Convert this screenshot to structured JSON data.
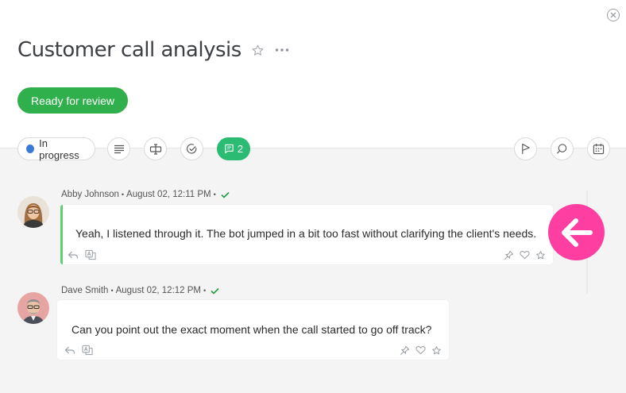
{
  "header": {
    "title": "Customer call analysis",
    "status_button": "Ready for review"
  },
  "toolbar": {
    "state_label": "In progress",
    "comment_count": "2",
    "colors": {
      "state_dot": "#3a7bd5",
      "comments_pill": "#2cbb73",
      "status_button": "#2fb04c"
    },
    "left_icons": [
      "description-icon",
      "custom-fields-icon",
      "checklist-icon",
      "comments-icon"
    ],
    "right_icons": [
      "flag-icon",
      "search-icon",
      "calendar-icon"
    ]
  },
  "messages": [
    {
      "author": "Abby Johnson",
      "time": "August 02, 12:11 PM",
      "text": "Yeah, I listened through it. The bot jumped in a bit too fast without clarifying the client's needs.",
      "highlighted": true
    },
    {
      "author": "Dave Smith",
      "time": "August 02, 12:12 PM",
      "text": "Can you point out the exact moment when the call started to go off track?",
      "highlighted": false
    }
  ],
  "message_actions": [
    "reply-icon",
    "translate-icon",
    "pin-icon",
    "like-icon",
    "star-icon"
  ],
  "accent": {
    "highlight_bar": "#5dcf6f",
    "pink_button": "#ff3ea1"
  }
}
